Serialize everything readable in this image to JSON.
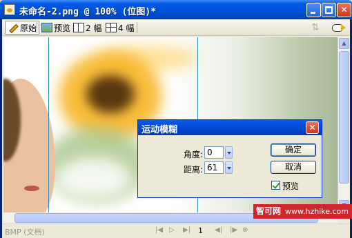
{
  "window": {
    "title": "未命名-2.png @ 100% (位图)*"
  },
  "toolbar": {
    "original_label": "原始",
    "preview_label": "预览",
    "two_up_label": "2 幅",
    "four_up_label": "4 幅"
  },
  "dialog": {
    "title": "运动模糊",
    "angle_label": "角度:",
    "angle_value": "0",
    "distance_label": "距离:",
    "distance_value": "61",
    "ok_label": "确定",
    "cancel_label": "取消",
    "preview_label": "预览",
    "preview_checked": true
  },
  "statusbar": {
    "doc_type": "BMP (文档)",
    "page_number": "1"
  },
  "watermark": {
    "brand": "智可网",
    "url": "www.hzhike.com"
  },
  "colors": {
    "titlebar": "#0058e6",
    "guide": "#2b8eb0",
    "watermark_bg": "#d0252b"
  }
}
